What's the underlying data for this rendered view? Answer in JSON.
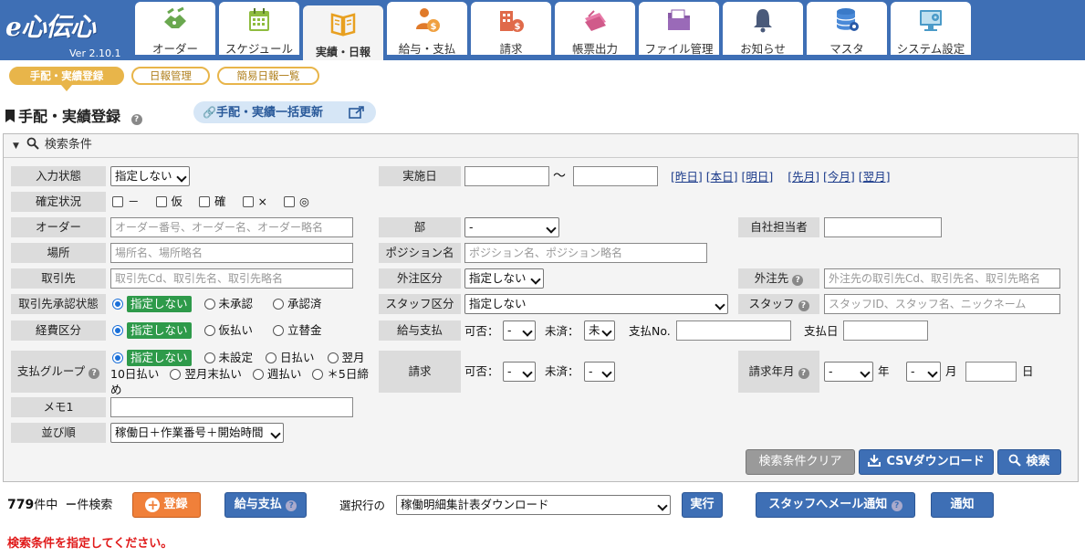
{
  "app": {
    "logo": "e心伝心",
    "version": "Ver 2.10.1"
  },
  "tabs": [
    {
      "label": "オーダー",
      "icon": "handshake-icon"
    },
    {
      "label": "スケジュール",
      "icon": "calendar-icon"
    },
    {
      "label": "実績・日報",
      "icon": "book-icon",
      "active": true
    },
    {
      "label": "給与・支払",
      "icon": "person-money-icon"
    },
    {
      "label": "請求",
      "icon": "building-money-icon"
    },
    {
      "label": "帳票出力",
      "icon": "papers-icon"
    },
    {
      "label": "ファイル管理",
      "icon": "folder-icon"
    },
    {
      "label": "お知らせ",
      "icon": "bell-icon"
    },
    {
      "label": "マスタ",
      "icon": "database-icon"
    },
    {
      "label": "システム設定",
      "icon": "monitor-gear-icon"
    }
  ],
  "subnav": [
    "手配・実績登録",
    "日報管理",
    "簡易日報一覧"
  ],
  "page": {
    "title": "手配・実績登録",
    "help": "?",
    "bulk_update": "手配・実績一括更新"
  },
  "search": {
    "header": "検索条件",
    "input_state": {
      "label": "入力状態",
      "value": "指定しない"
    },
    "confirm": {
      "label": "確定状況",
      "options": [
        "－",
        "仮",
        "確",
        "×",
        "◎"
      ]
    },
    "order": {
      "label": "オーダー",
      "placeholder": "オーダー番号、オーダー名、オーダー略名"
    },
    "place": {
      "label": "場所",
      "placeholder": "場所名、場所略名"
    },
    "client": {
      "label": "取引先",
      "placeholder": "取引先Cd、取引先名、取引先略名"
    },
    "client_approval": {
      "label": "取引先承認状態",
      "options": [
        "指定しない",
        "未承認",
        "承認済"
      ]
    },
    "expense": {
      "label": "経費区分",
      "options": [
        "指定しない",
        "仮払い",
        "立替金"
      ]
    },
    "pay_group": {
      "label": "支払グループ",
      "options": [
        "指定しない",
        "未設定",
        "日払い",
        "翌月10日払い",
        "翌月末払い",
        "週払い",
        "＊5日締め"
      ]
    },
    "memo": {
      "label": "メモ1"
    },
    "sort": {
      "label": "並び順",
      "value": "稼働日＋作業番号＋開始時間"
    },
    "date": {
      "label": "実施日",
      "tilde": "～",
      "links": [
        "[昨日]",
        "[本日]",
        "[明日]",
        "[先月]",
        "[今月]",
        "[翌月]"
      ]
    },
    "dept": {
      "label": "部",
      "value": "-"
    },
    "in_charge": {
      "label": "自社担当者"
    },
    "position": {
      "label": "ポジション名",
      "placeholder": "ポジション名、ポジション略名"
    },
    "outsource_type": {
      "label": "外注区分",
      "value": "指定しない"
    },
    "outsource": {
      "label": "外注先",
      "placeholder": "外注先の取引先Cd、取引先名、取引先略名"
    },
    "staff_type": {
      "label": "スタッフ区分",
      "value": "指定しない"
    },
    "staff": {
      "label": "スタッフ",
      "placeholder": "スタッフID、スタッフ名、ニックネーム"
    },
    "salary": {
      "label": "給与支払",
      "can": "可否：",
      "can_value": "-",
      "unsettled": "未済：",
      "unsettled_value": "未",
      "payno": "支払No.",
      "paydate": "支払日"
    },
    "billing": {
      "label": "請求",
      "can": "可否：",
      "can_value": "-",
      "unsettled": "未済：",
      "unsettled_value": "-"
    },
    "bill_month": {
      "label": "請求年月",
      "year_value": "-",
      "year": "年",
      "month_value": "-",
      "month": "月",
      "day": "日"
    },
    "buttons": {
      "clear": "検索条件クリア",
      "csv": "CSVダウンロード",
      "search": "検索"
    }
  },
  "footer": {
    "count": "779",
    "count_suffix": "件中",
    "dash": "－",
    "searched": "件検索",
    "register": "登録",
    "salary_pay": "給与支払",
    "selected_rows": "選択行の",
    "action_value": "稼働明細集計表ダウンロード",
    "execute": "実行",
    "mail_notify": "スタッフへメール通知",
    "notify": "通知"
  },
  "message": "検索条件を指定してください。"
}
